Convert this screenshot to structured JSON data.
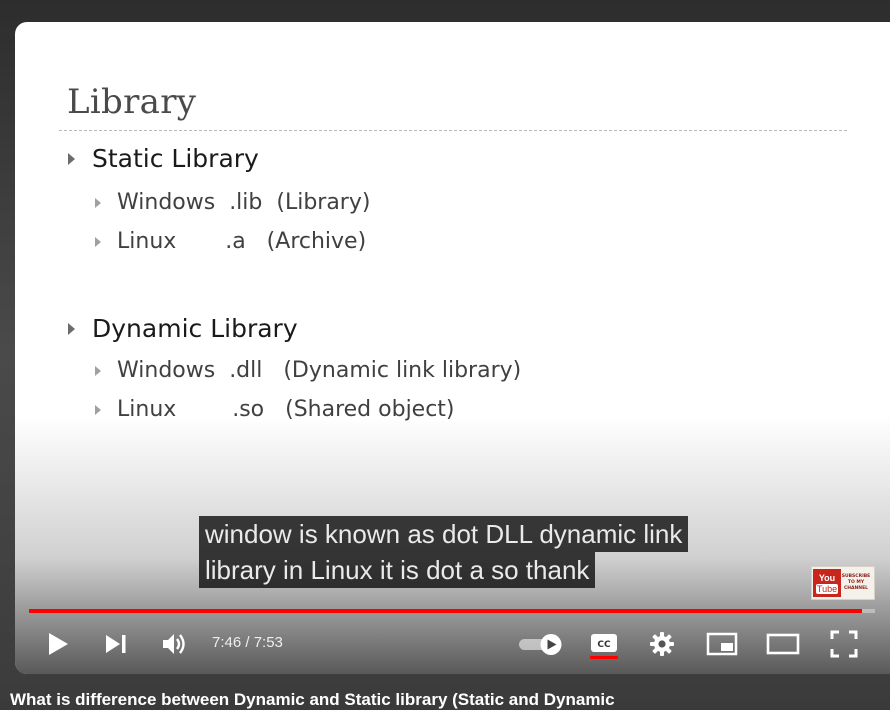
{
  "slide": {
    "title": "Library",
    "sections": [
      {
        "heading": "Static Library",
        "items": [
          "Windows  .lib  (Library)",
          "Linux       .a   (Archive)"
        ]
      },
      {
        "heading": "Dynamic Library",
        "items": [
          "Windows  .dll   (Dynamic link library)",
          "Linux        .so   (Shared object)"
        ]
      }
    ]
  },
  "captions": {
    "line1": "window is known as dot DLL dynamic link",
    "line2": "library in Linux it is dot a so thank"
  },
  "watermark": {
    "top": "You",
    "bottom": "Tube",
    "text": "SUBSCRIBE TO MY CHANNEL"
  },
  "player": {
    "time_display": "7:46 / 7:53",
    "progress_fraction": 0.985,
    "icons": [
      "play-icon",
      "next-icon",
      "volume-icon",
      "autoplay-toggle-icon",
      "captions-icon",
      "settings-icon",
      "miniplayer-icon",
      "theater-icon",
      "fullscreen-icon"
    ],
    "captions_on": true,
    "accent_color": "#ff0000"
  },
  "video": {
    "title": "What is difference between Dynamic and Static library (Static and Dynamic"
  }
}
